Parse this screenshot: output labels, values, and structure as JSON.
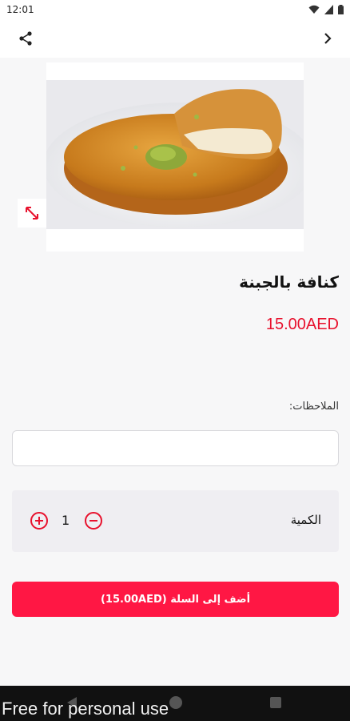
{
  "status": {
    "time": "12:01"
  },
  "appbar": {
    "share_icon": "share-icon",
    "forward_icon": "chevron-right-icon"
  },
  "product": {
    "title": "كنافة بالجبنة",
    "price": "15.00AED",
    "image_icon": "expand-icon"
  },
  "notes": {
    "label": "الملاحظات:",
    "value": ""
  },
  "quantity": {
    "label": "الكمية",
    "value": "1"
  },
  "cta": {
    "label": "أضف إلى السلة (15.00AED)"
  },
  "watermark": "Free for personal use",
  "colors": {
    "accent": "#ff1744",
    "price": "#e8112d"
  }
}
